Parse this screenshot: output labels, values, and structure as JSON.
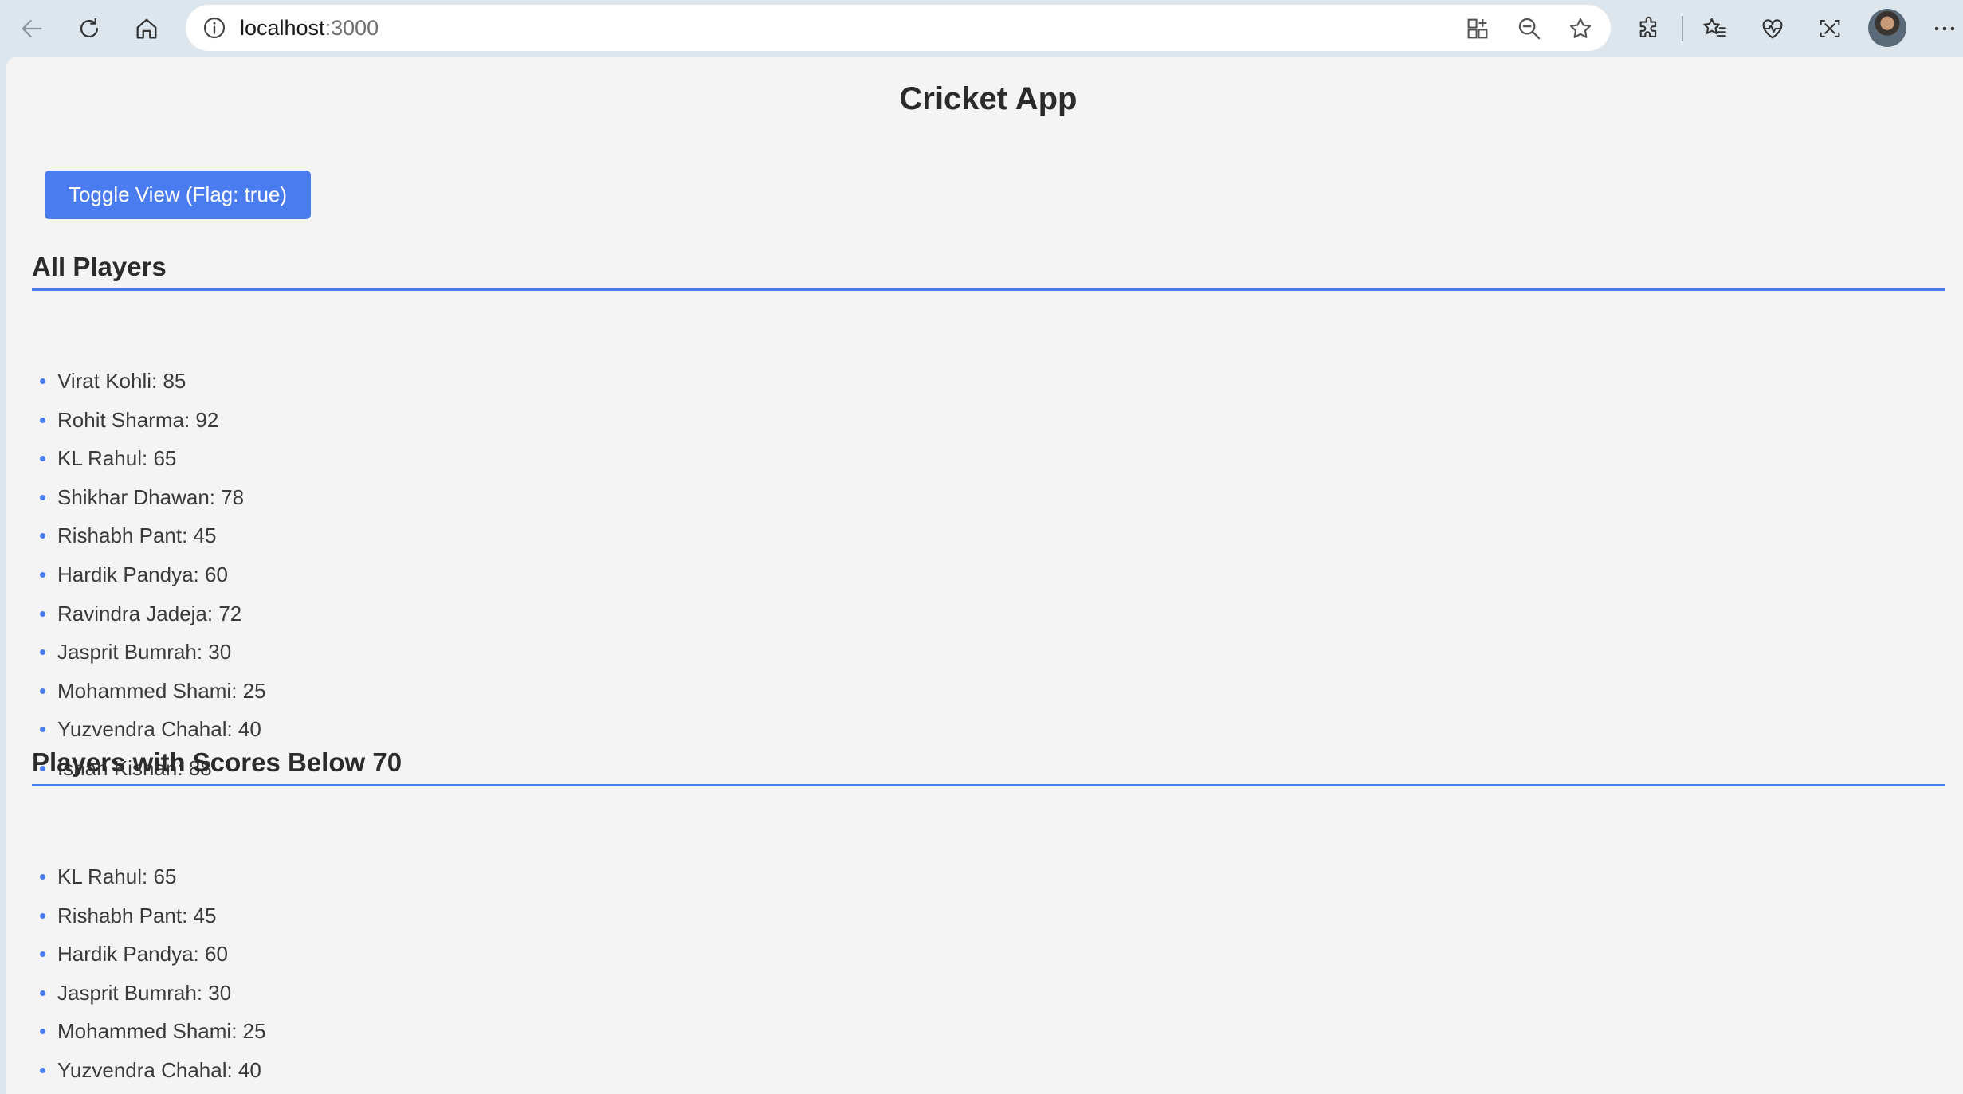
{
  "browser": {
    "url_host": "localhost",
    "url_port": ":3000"
  },
  "app": {
    "title": "Cricket App",
    "toggle_button_label": "Toggle View (Flag: true)"
  },
  "sections": {
    "all_players": {
      "title": "All Players",
      "players": [
        "Virat Kohli: 85",
        "Rohit Sharma: 92",
        "KL Rahul: 65",
        "Shikhar Dhawan: 78",
        "Rishabh Pant: 45",
        "Hardik Pandya: 60",
        "Ravindra Jadeja: 72",
        "Jasprit Bumrah: 30",
        "Mohammed Shami: 25",
        "Yuzvendra Chahal: 40",
        "Ishan Kishan: 88"
      ]
    },
    "below_70": {
      "title": "Players with Scores Below 70",
      "players": [
        "KL Rahul: 65",
        "Rishabh Pant: 45",
        "Hardik Pandya: 60",
        "Jasprit Bumrah: 30",
        "Mohammed Shami: 25",
        "Yuzvendra Chahal: 40"
      ]
    }
  },
  "colors": {
    "accent": "#4a7cf0",
    "page_background": "#f4f4f4",
    "chrome_background": "#dce6ec"
  }
}
